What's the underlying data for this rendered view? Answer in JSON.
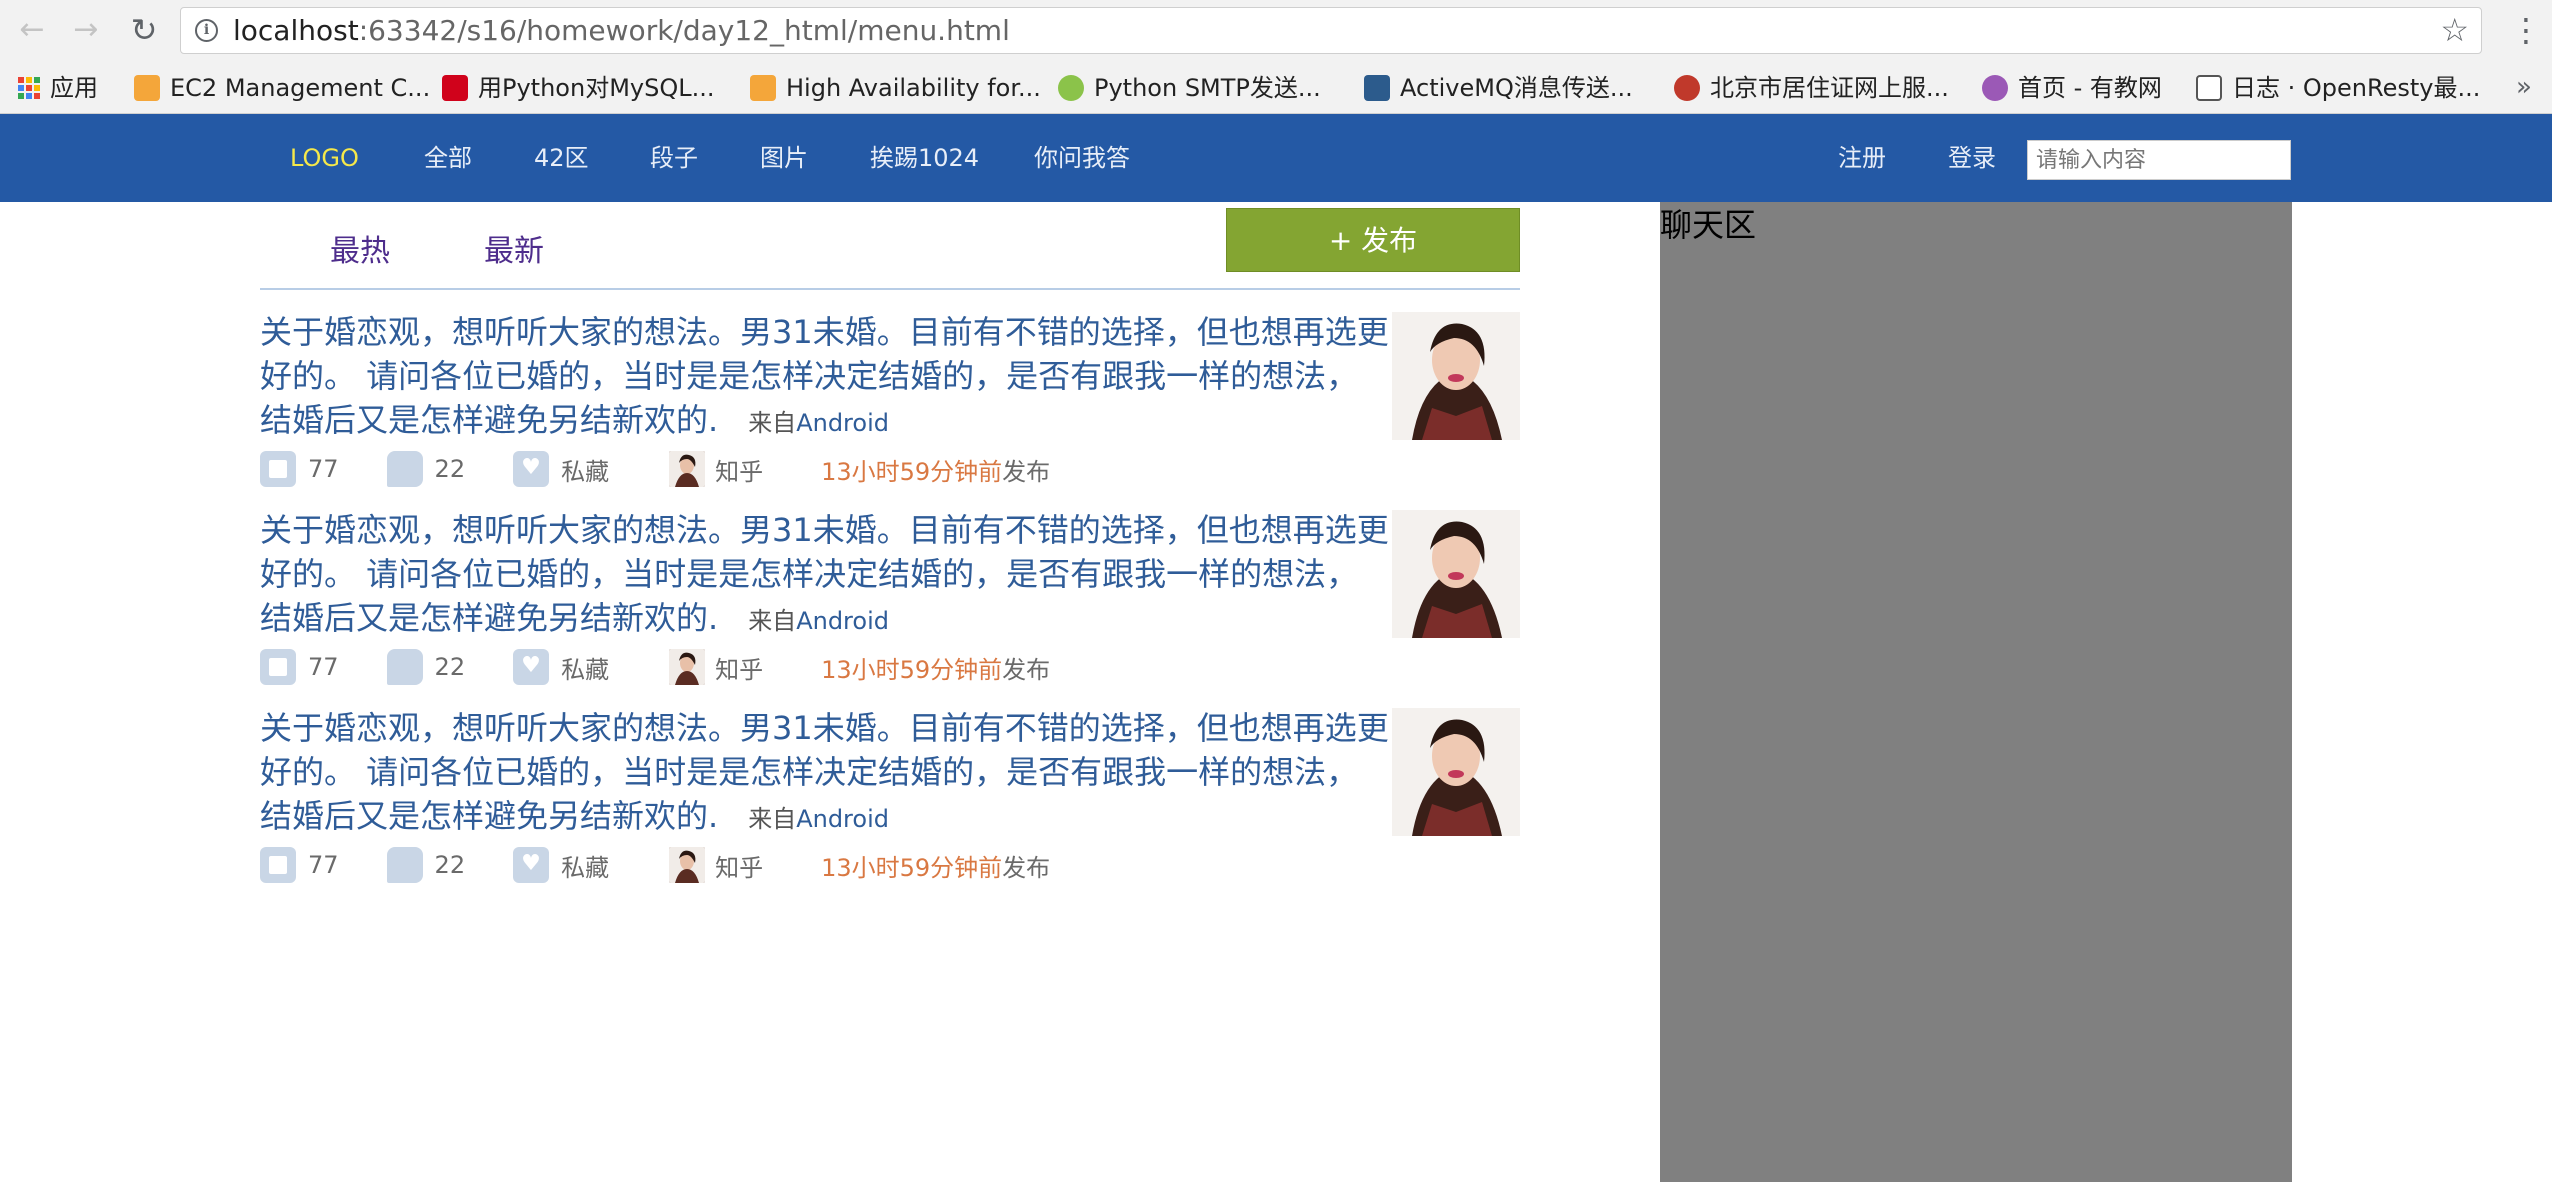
{
  "browser": {
    "url_host": "localhost",
    "url_rest": ":63342/s16/homework/day12_html/menu.html",
    "bookmarks": [
      {
        "label": "应用",
        "icon": "apps-grid-icon"
      },
      {
        "label": "EC2 Management C...",
        "icon": "aws-icon",
        "color": "#f4a63a"
      },
      {
        "label": "用Python对MySQL...",
        "icon": "csdn-icon",
        "color": "#d0021b"
      },
      {
        "label": "High Availability for...",
        "icon": "aws-icon",
        "color": "#f4a63a"
      },
      {
        "label": "Python SMTP发送...",
        "icon": "runoob-icon",
        "color": "#8bc34a"
      },
      {
        "label": "ActiveMQ消息传送...",
        "icon": "cnblogs-icon",
        "color": "#2c5b8c"
      },
      {
        "label": "北京市居住证网上服...",
        "icon": "police-badge-icon",
        "color": "#c0392b"
      },
      {
        "label": "首页 - 有教网",
        "icon": "youjiao-icon",
        "color": "#9b59b6"
      },
      {
        "label": "日志 · OpenResty最...",
        "icon": "book-icon",
        "color": "#555555"
      }
    ],
    "more": "»"
  },
  "header": {
    "logo": "LOGO",
    "nav": [
      "全部",
      "42区",
      "段子",
      "图片",
      "挨踢1024",
      "你问我答"
    ],
    "register": "注册",
    "login": "登录",
    "search_placeholder": "请输入内容"
  },
  "tabs": {
    "hot": "最热",
    "new": "最新",
    "publish": "+ 发布"
  },
  "items": [
    {
      "title": "关于婚恋观，想听听大家的想法。男31未婚。目前有不错的选择，但也想再选更好的。 请问各位已婚的，当时是是怎样决定结婚的，是否有跟我一样的想法，结婚后又是怎样避免另结新欢的.",
      "from": "来自",
      "os": "Android",
      "likes": "77",
      "comments": "22",
      "fav": "私藏",
      "author": "知乎",
      "ago": "13小时59分钟前",
      "published": "发布"
    },
    {
      "title": "关于婚恋观，想听听大家的想法。男31未婚。目前有不错的选择，但也想再选更好的。 请问各位已婚的，当时是是怎样决定结婚的，是否有跟我一样的想法，结婚后又是怎样避免另结新欢的.",
      "from": "来自",
      "os": "Android",
      "likes": "77",
      "comments": "22",
      "fav": "私藏",
      "author": "知乎",
      "ago": "13小时59分钟前",
      "published": "发布"
    },
    {
      "title": "关于婚恋观，想听听大家的想法。男31未婚。目前有不错的选择，但也想再选更好的。 请问各位已婚的，当时是是怎样决定结婚的，是否有跟我一样的想法，结婚后又是怎样避免另结新欢的.",
      "from": "来自",
      "os": "Android",
      "likes": "77",
      "comments": "22",
      "fav": "私藏",
      "author": "知乎",
      "ago": "13小时59分钟前",
      "published": "发布"
    }
  ],
  "chat": {
    "title": "聊天区"
  }
}
